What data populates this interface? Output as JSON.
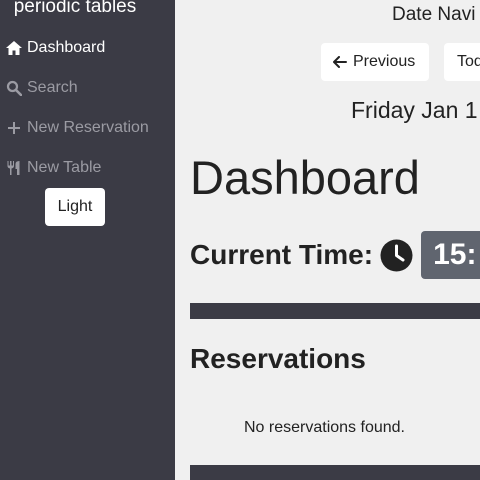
{
  "sidebar": {
    "brand": "periodic tables",
    "items": [
      {
        "label": "Dashboard",
        "icon": "home-icon"
      },
      {
        "label": "Search",
        "icon": "search-icon"
      },
      {
        "label": "New Reservation",
        "icon": "plus-icon"
      },
      {
        "label": "New Table",
        "icon": "utensils-icon"
      }
    ],
    "theme_button": "Light"
  },
  "main": {
    "date_nav_title": "Date Navi",
    "prev_button": "Previous",
    "today_button": "Tod",
    "current_date": "Friday Jan 1",
    "title": "Dashboard",
    "current_time_label": "Current Time:",
    "current_time_value": "15:",
    "reservations_heading": "Reservations",
    "empty_message": "No reservations found."
  },
  "colors": {
    "sidebar_bg": "#3b3b45",
    "content_bg": "#f0f0f0",
    "time_badge_bg": "#60656f"
  }
}
